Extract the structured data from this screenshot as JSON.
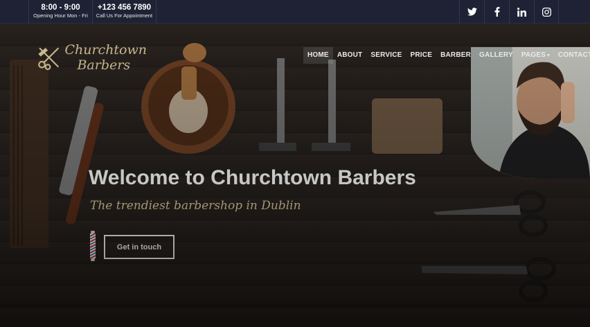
{
  "topbar": {
    "hours": {
      "title": "8:00 - 9:00",
      "subtitle": "Opening Hour Mon - Fri"
    },
    "phone": {
      "title": "+123 456 7890",
      "subtitle": "Call Us For Appointment"
    },
    "social": [
      {
        "name": "twitter-icon",
        "glyph": "twitter"
      },
      {
        "name": "facebook-icon",
        "glyph": "facebook"
      },
      {
        "name": "linkedin-icon",
        "glyph": "linkedin"
      },
      {
        "name": "instagram-icon",
        "glyph": "instagram"
      }
    ]
  },
  "logo": {
    "line1": "Churchtown",
    "line2": "Barbers",
    "icon": "scissors-comb-icon"
  },
  "nav": {
    "items": [
      "HOME",
      "ABOUT",
      "SERVICE",
      "PRICE",
      "BARBER",
      "GALLERY",
      "PAGES",
      "CONTACT"
    ],
    "active": "HOME"
  },
  "hero": {
    "heading": "Welcome to Churchtown Barbers",
    "subheading": "The trendiest barbershop in Dublin",
    "cta": "Get in touch"
  },
  "colors": {
    "topbar": "#1f2235",
    "accent": "#d8c79a",
    "text": "#ffffff"
  }
}
